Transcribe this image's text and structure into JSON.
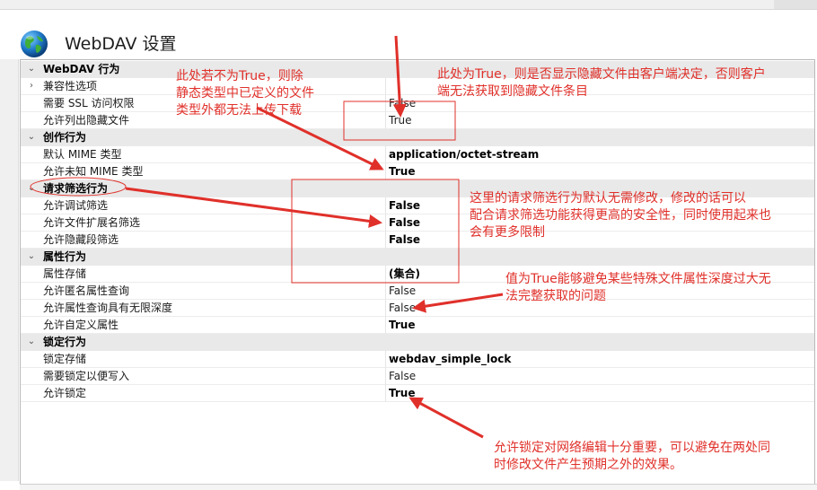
{
  "window": {
    "title": "WebDAV 设置"
  },
  "grid": {
    "rows": [
      {
        "kind": "cat",
        "label": "WebDAV 行为",
        "chev": "⌄",
        "value": ""
      },
      {
        "kind": "prop",
        "label": "兼容性选项",
        "chev": "›",
        "value": "",
        "bold": false
      },
      {
        "kind": "prop",
        "label": "需要 SSL 访问权限",
        "value": "False",
        "bold": false
      },
      {
        "kind": "prop",
        "label": "允许列出隐藏文件",
        "value": "True",
        "bold": false
      },
      {
        "kind": "cat",
        "label": "创作行为",
        "chev": "⌄",
        "value": ""
      },
      {
        "kind": "prop",
        "label": "默认 MIME 类型",
        "value": "application/octet-stream",
        "bold": true
      },
      {
        "kind": "prop",
        "label": "允许未知 MIME 类型",
        "value": "True",
        "bold": true
      },
      {
        "kind": "cat",
        "label": "请求筛选行为",
        "chev": "⌄",
        "value": ""
      },
      {
        "kind": "prop",
        "label": "允许调试筛选",
        "value": "False",
        "bold": true
      },
      {
        "kind": "prop",
        "label": "允许文件扩展名筛选",
        "value": "False",
        "bold": true
      },
      {
        "kind": "prop",
        "label": "允许隐藏段筛选",
        "value": "False",
        "bold": true
      },
      {
        "kind": "cat",
        "label": "属性行为",
        "chev": "⌄",
        "value": ""
      },
      {
        "kind": "prop",
        "label": "属性存储",
        "value": "(集合)",
        "bold": true
      },
      {
        "kind": "prop",
        "label": "允许匿名属性查询",
        "value": "False",
        "bold": false
      },
      {
        "kind": "prop",
        "label": "允许属性查询具有无限深度",
        "value": "False",
        "bold": false
      },
      {
        "kind": "prop",
        "label": "允许自定义属性",
        "value": "True",
        "bold": true
      },
      {
        "kind": "cat",
        "label": "锁定行为",
        "chev": "⌄",
        "value": ""
      },
      {
        "kind": "prop",
        "label": "锁定存储",
        "value": "webdav_simple_lock",
        "bold": true
      },
      {
        "kind": "prop",
        "label": "需要锁定以便写入",
        "value": "False",
        "bold": false
      },
      {
        "kind": "prop",
        "label": "允许锁定",
        "value": "True",
        "bold": true
      }
    ]
  },
  "annotations": {
    "note1": [
      "此处若不为True，则除",
      "静态类型中已定义的文件",
      "类型外都无法上传下载"
    ],
    "note2": [
      "此处为True，则是否显示隐藏文件由客户端决定，否则客户",
      "端无法获取到隐藏文件条目"
    ],
    "note3": [
      "这里的请求筛选行为默认无需修改，修改的话可以",
      "配合请求筛选功能获得更高的安全性，同时使用起来也",
      "会有更多限制"
    ],
    "note4": [
      "值为True能够避免某些特殊文件属性深度过大无",
      "法完整获取的问题"
    ],
    "note5": [
      "允许锁定对网络编辑十分重要，可以避免在两处同",
      "时修改文件产生预期之外的效果。"
    ]
  },
  "colors": {
    "annotation": "#e0302a",
    "category_bg": "#e9e9e9"
  },
  "icons": {
    "app": "globe-icon",
    "expand": "chevron-down-icon",
    "collapsed": "chevron-right-icon"
  }
}
